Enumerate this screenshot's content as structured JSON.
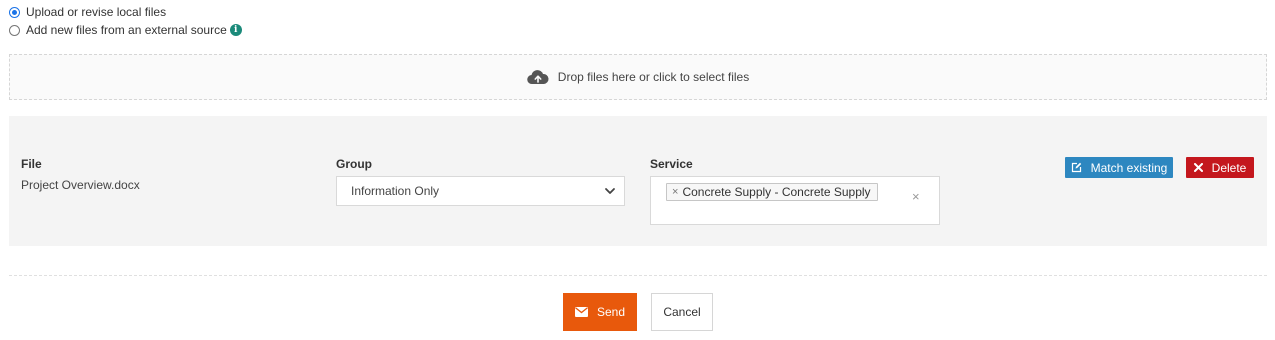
{
  "upload_mode": {
    "options": [
      {
        "label": "Upload or revise local files",
        "selected": true
      },
      {
        "label": "Add new files from an external source",
        "selected": false,
        "icon": "info-icon"
      }
    ]
  },
  "dropzone": {
    "text": "Drop files here or click to select files",
    "icon": "cloud-upload-icon"
  },
  "file_row": {
    "file_label": "File",
    "file_name": "Project Overview.docx",
    "group_label": "Group",
    "group_value": "Information Only",
    "service_label": "Service",
    "service_tags": [
      "Concrete Supply - Concrete Supply"
    ],
    "tag_remove_glyph": "×",
    "clear_glyph": "×",
    "match_button": "Match existing",
    "delete_button": "Delete"
  },
  "actions": {
    "send": "Send",
    "cancel": "Cancel"
  },
  "colors": {
    "match": "#2d87c0",
    "delete": "#c4171d",
    "send": "#e8590c",
    "info": "#1b8a7a",
    "radio": "#1a73e8"
  }
}
